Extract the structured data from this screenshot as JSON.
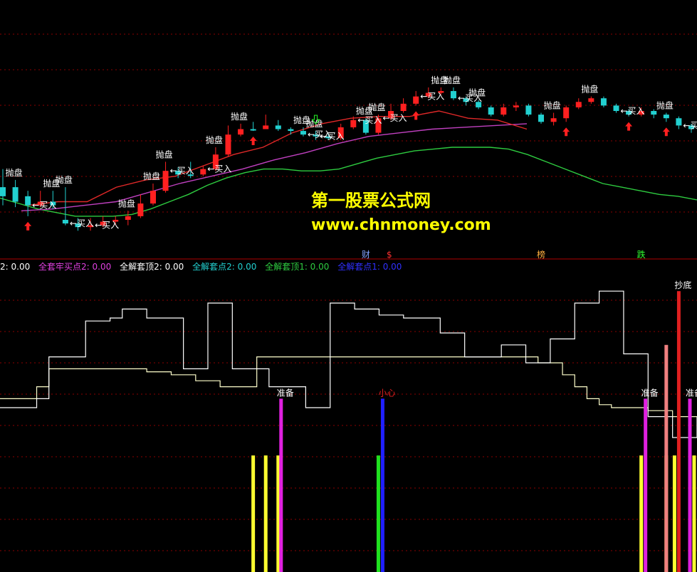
{
  "colors": {
    "background": "#000000",
    "grid": "#8b0000",
    "divider": "#b00000",
    "up_candle": "#ff2020",
    "down_candle": "#22d0d0",
    "ma_green": "#2ecc40",
    "ma_red": "#e02828",
    "ma_magenta": "#c040c0",
    "sell_label": "#ffffff",
    "buy_label": "#ffffff",
    "arrow_red": "#ff2020",
    "arrow_green": "#22dd22",
    "yellow": "#ffff30",
    "magenta": "#e020e0",
    "blue": "#2020ff",
    "green": "#20e020",
    "red": "#e02020",
    "pink": "#f08080",
    "white_line": "#ffffff",
    "cream_line": "#ffffcc"
  },
  "watermark": {
    "title": "第一股票公式网",
    "url": "www.chnmoney.com"
  },
  "legend": [
    {
      "text": "2: 0.00",
      "color": "#ffffff"
    },
    {
      "text": "全套牢买点2: 0.00",
      "color": "#e040e0"
    },
    {
      "text": "全解套顶2: 0.00",
      "color": "#ffffff"
    },
    {
      "text": "全解套点2: 0.00",
      "color": "#22d0d0"
    },
    {
      "text": "全解套顶1: 0.00",
      "color": "#2ecc40"
    },
    {
      "text": "全解套点1: 0.00",
      "color": "#3030ff"
    }
  ],
  "chart_data": [
    {
      "type": "candlestick",
      "title": "",
      "sell_label": "抛盘",
      "buy_label": "←买入",
      "event_tags": [
        {
          "text": "财",
          "color": "#80a0ff",
          "bar": 29
        },
        {
          "text": "$",
          "color": "#ff3030",
          "bar": 31
        },
        {
          "text": "榜",
          "color": "#ffb040",
          "bar": 43
        },
        {
          "text": "跌",
          "color": "#30ff30",
          "bar": 51
        }
      ],
      "candles": [
        [
          0.62,
          0.67,
          0.52,
          0.72
        ],
        [
          0.62,
          0.7,
          0.58,
          0.73
        ],
        [
          0.67,
          0.72,
          0.64,
          0.78
        ],
        [
          0.72,
          0.7,
          0.64,
          0.73
        ],
        [
          0.7,
          0.72,
          0.64,
          0.74
        ],
        [
          0.8,
          0.82,
          0.62,
          0.83
        ],
        [
          0.82,
          0.84,
          0.79,
          0.86
        ],
        [
          0.84,
          0.83,
          0.79,
          0.86
        ],
        [
          0.83,
          0.81,
          0.78,
          0.84
        ],
        [
          0.81,
          0.8,
          0.78,
          0.83
        ],
        [
          0.8,
          0.78,
          0.75,
          0.83
        ],
        [
          0.78,
          0.71,
          0.66,
          0.79
        ],
        [
          0.71,
          0.64,
          0.6,
          0.72
        ],
        [
          0.64,
          0.53,
          0.48,
          0.65
        ],
        [
          0.53,
          0.55,
          0.51,
          0.57
        ],
        [
          0.55,
          0.55,
          0.48,
          0.57
        ],
        [
          0.55,
          0.52,
          0.5,
          0.56
        ],
        [
          0.52,
          0.44,
          0.4,
          0.53
        ],
        [
          0.44,
          0.33,
          0.28,
          0.45
        ],
        [
          0.33,
          0.3,
          0.27,
          0.34
        ],
        [
          0.3,
          0.3,
          0.26,
          0.31
        ],
        [
          0.3,
          0.28,
          0.22,
          0.3
        ],
        [
          0.28,
          0.3,
          0.25,
          0.31
        ],
        [
          0.3,
          0.31,
          0.29,
          0.33
        ],
        [
          0.31,
          0.33,
          0.29,
          0.34
        ],
        [
          0.33,
          0.34,
          0.31,
          0.36
        ],
        [
          0.34,
          0.35,
          0.32,
          0.36
        ],
        [
          0.35,
          0.29,
          0.27,
          0.36
        ],
        [
          0.29,
          0.25,
          0.23,
          0.3
        ],
        [
          0.25,
          0.32,
          0.24,
          0.33
        ],
        [
          0.32,
          0.24,
          0.22,
          0.33
        ],
        [
          0.24,
          0.2,
          0.16,
          0.25
        ],
        [
          0.2,
          0.16,
          0.13,
          0.21
        ],
        [
          0.16,
          0.12,
          0.09,
          0.17
        ],
        [
          0.12,
          0.1,
          0.07,
          0.13
        ],
        [
          0.1,
          0.09,
          0.07,
          0.11
        ],
        [
          0.09,
          0.13,
          0.07,
          0.14
        ],
        [
          0.13,
          0.15,
          0.12,
          0.17
        ],
        [
          0.15,
          0.18,
          0.14,
          0.19
        ],
        [
          0.18,
          0.22,
          0.17,
          0.23
        ],
        [
          0.22,
          0.18,
          0.16,
          0.23
        ],
        [
          0.18,
          0.17,
          0.15,
          0.2
        ],
        [
          0.17,
          0.22,
          0.16,
          0.23
        ],
        [
          0.22,
          0.26,
          0.21,
          0.27
        ],
        [
          0.26,
          0.24,
          0.21,
          0.28
        ],
        [
          0.24,
          0.18,
          0.17,
          0.26
        ],
        [
          0.18,
          0.15,
          0.13,
          0.19
        ],
        [
          0.15,
          0.13,
          0.12,
          0.16
        ],
        [
          0.13,
          0.17,
          0.12,
          0.18
        ],
        [
          0.17,
          0.2,
          0.16,
          0.21
        ],
        [
          0.2,
          0.22,
          0.19,
          0.23
        ],
        [
          0.22,
          0.2,
          0.18,
          0.23
        ],
        [
          0.2,
          0.22,
          0.19,
          0.24
        ],
        [
          0.22,
          0.24,
          0.21,
          0.26
        ],
        [
          0.24,
          0.28,
          0.23,
          0.3
        ],
        [
          0.28,
          0.3,
          0.27,
          0.32
        ]
      ],
      "ma_green": [
        0.68,
        0.71,
        0.74,
        0.76,
        0.78,
        0.78,
        0.78,
        0.77,
        0.74,
        0.7,
        0.66,
        0.61,
        0.57,
        0.54,
        0.52,
        0.52,
        0.53,
        0.53,
        0.52,
        0.49,
        0.46,
        0.44,
        0.42,
        0.41,
        0.4,
        0.4,
        0.4,
        0.41,
        0.44,
        0.48,
        0.52,
        0.56,
        0.6,
        0.62,
        0.64,
        0.66,
        0.67,
        0.69
      ],
      "ma_red": [
        0.72,
        0.7,
        0.7,
        0.62,
        0.58,
        0.56,
        0.5,
        0.44,
        0.4,
        0.32,
        0.27,
        0.24,
        0.23,
        0.23,
        0.2,
        0.24,
        0.25,
        0.3
      ],
      "ma_magenta": [
        0.75,
        0.74,
        0.72,
        0.7,
        0.65,
        0.6,
        0.56,
        0.52,
        0.47,
        0.43,
        0.38,
        0.34,
        0.32,
        0.3,
        0.29,
        0.28,
        0.27
      ],
      "sell_marks": [
        1,
        4,
        5,
        10,
        12,
        13,
        17,
        19,
        24,
        25,
        29,
        30,
        35,
        36,
        38,
        44,
        47,
        53
      ],
      "buy_marks": [
        2,
        5,
        7,
        13,
        16,
        24,
        25,
        28,
        30,
        33,
        36,
        49,
        54
      ],
      "up_arrows": [
        2,
        20,
        33,
        45,
        50,
        53
      ],
      "down_arrows": [
        25
      ]
    },
    {
      "type": "indicator",
      "title": "",
      "labels": {
        "prepare": "准备",
        "careful": "小心",
        "bottom": "抄底"
      },
      "white_line": [
        0.55,
        0.55,
        0.55,
        0.58,
        0.72,
        0.72,
        0.72,
        0.84,
        0.84,
        0.85,
        0.88,
        0.88,
        0.85,
        0.85,
        0.85,
        0.68,
        0.68,
        0.9,
        0.9,
        0.68,
        0.68,
        0.68,
        0.62,
        0.62,
        0.62,
        0.55,
        0.55,
        0.9,
        0.9,
        0.88,
        0.88,
        0.86,
        0.86,
        0.85,
        0.85,
        0.85,
        0.8,
        0.8,
        0.72,
        0.72,
        0.72,
        0.76,
        0.76,
        0.7,
        0.7,
        0.78,
        0.78,
        0.9,
        0.9,
        0.94,
        0.94,
        0.73,
        0.73,
        0.52,
        0.52,
        0.45,
        0.45,
        0.52
      ],
      "cream_line": [
        0.58,
        0.58,
        0.58,
        0.62,
        0.68,
        0.68,
        0.68,
        0.68,
        0.68,
        0.68,
        0.68,
        0.68,
        0.67,
        0.67,
        0.66,
        0.66,
        0.64,
        0.64,
        0.62,
        0.62,
        0.62,
        0.72,
        0.72,
        0.72,
        0.72,
        0.72,
        0.72,
        0.72,
        0.72,
        0.72,
        0.72,
        0.72,
        0.72,
        0.72,
        0.72,
        0.72,
        0.72,
        0.72,
        0.72,
        0.72,
        0.72,
        0.72,
        0.72,
        0.72,
        0.7,
        0.7,
        0.66,
        0.62,
        0.58,
        0.56,
        0.55,
        0.55,
        0.55,
        0.54,
        0.54,
        0.52,
        0.52,
        0.52
      ],
      "bars": [
        {
          "bar": 20,
          "color": "yellow",
          "value": 0.39
        },
        {
          "bar": 21,
          "color": "yellow",
          "value": 0.39
        },
        {
          "bar": 22,
          "color": "yellow",
          "value": 0.39
        },
        {
          "bar": 22,
          "color": "magenta",
          "value": 0.58,
          "label": "prepare",
          "offset": 4
        },
        {
          "bar": 30,
          "color": "green",
          "value": 0.39
        },
        {
          "bar": 30,
          "color": "blue",
          "value": 0.58,
          "label": "careful",
          "offset": 6
        },
        {
          "bar": 51,
          "color": "yellow",
          "value": 0.39
        },
        {
          "bar": 51,
          "color": "magenta",
          "value": 0.58,
          "label": "prepare",
          "offset": 6
        },
        {
          "bar": 53,
          "color": "yellow",
          "value": 0.39
        },
        {
          "bar": 53,
          "color": "pink",
          "value": 0.76
        },
        {
          "bar": 54,
          "color": "red",
          "value": 0.94,
          "label": "bottom",
          "offset": 0
        },
        {
          "bar": 54,
          "color": "yellow",
          "value": 0.39,
          "offset": -6
        },
        {
          "bar": 55,
          "color": "magenta",
          "value": 0.58,
          "label": "prepare",
          "offset": -2
        },
        {
          "bar": 55,
          "color": "yellow",
          "value": 0.39,
          "offset": 4
        },
        {
          "bar": 56,
          "color": "magenta",
          "value": 0.58,
          "offset": 8
        },
        {
          "bar": 56,
          "color": "pink",
          "value": 0.76,
          "offset": 14
        },
        {
          "bar": 57,
          "color": "yellow",
          "value": 0.39,
          "offset": -4
        },
        {
          "bar": 57,
          "color": "pink",
          "value": 0.76,
          "offset": 2
        },
        {
          "bar": 57,
          "color": "red",
          "value": 0.94,
          "label": "bottom",
          "offset": 8
        },
        {
          "bar": 57,
          "color": "pink",
          "value": 0.76,
          "offset": 14
        },
        {
          "bar": 57,
          "color": "red",
          "value": 0.94,
          "offset": 20
        }
      ]
    }
  ]
}
